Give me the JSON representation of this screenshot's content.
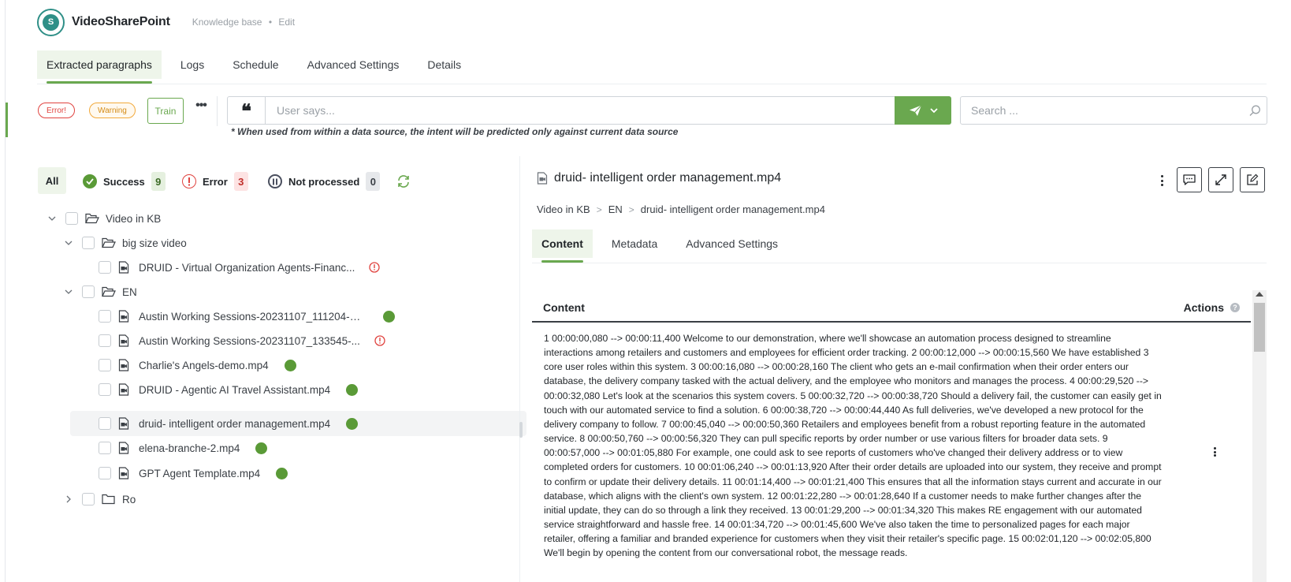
{
  "header": {
    "app_title": "VideoSharePoint",
    "logo_letter": "S",
    "breadcrumb_section": "Knowledge base",
    "breadcrumb_sep": "•",
    "breadcrumb_action": "Edit"
  },
  "tabs": [
    {
      "label": "Extracted paragraphs",
      "active": true
    },
    {
      "label": "Logs"
    },
    {
      "label": "Schedule"
    },
    {
      "label": "Advanced Settings"
    },
    {
      "label": "Details"
    }
  ],
  "toolbar": {
    "error_pill": "Error!",
    "warning_pill": "Warning",
    "train_label": "Train",
    "more_label": "•••",
    "quote_glyph": "❝",
    "user_says_placeholder": "User says...",
    "intent_note": "* When used from within a data source, the intent will be predicted only against current data source",
    "search_placeholder": "Search ..."
  },
  "filters": {
    "all_label": "All",
    "success_label": "Success",
    "success_count": "9",
    "error_label": "Error",
    "error_count": "3",
    "not_processed_label": "Not processed",
    "not_processed_count": "0"
  },
  "tree": {
    "root": "Video in KB",
    "folder_big": "big size video",
    "file_druid_virtual": "DRUID - Virtual Organization Agents-Financ...",
    "folder_en": "EN",
    "file_austin_1": "Austin Working Sessions-20231107_111204-M...",
    "file_austin_2": "Austin Working Sessions-20231107_133545-...",
    "file_charlie": "Charlie's Angels-demo.mp4",
    "file_travel": "DRUID - Agentic AI Travel Assistant.mp4",
    "file_order": "druid- intelligent order management.mp4",
    "file_elena": "elena-branche-2.mp4",
    "file_gpt": "GPT Agent Template.mp4",
    "folder_ro": "Ro"
  },
  "document": {
    "title": "druid- intelligent order management.mp4",
    "crumbs": [
      "Video in KB",
      "EN",
      "druid- intelligent order management.mp4"
    ],
    "crumb_sep": ">",
    "sub_tabs": [
      {
        "label": "Content",
        "active": true
      },
      {
        "label": "Metadata"
      },
      {
        "label": "Advanced Settings"
      }
    ],
    "content_header": "Content",
    "actions_header": "Actions",
    "help_glyph": "?",
    "content_text": "1 00:00:00,080 --> 00:00:11,400 Welcome to our demonstration, where we'll showcase an automation process designed to streamline interactions among retailers and customers and employees for efficient order tracking. 2 00:00:12,000 --> 00:00:15,560 We have established 3 core user roles within this system. 3 00:00:16,080 --> 00:00:28,160 The client who gets an e-mail confirmation when their order enters our database, the delivery company tasked with the actual delivery, and the employee who monitors and manages the process. 4 00:00:29,520 --> 00:00:32,080 Let's look at the scenarios this system covers. 5 00:00:32,720 --> 00:00:38,720 Should a delivery fail, the customer can easily get in touch with our automated service to find a solution. 6 00:00:38,720 --> 00:00:44,440 As full deliveries, we've developed a new protocol for the delivery company to follow. 7 00:00:45,040 --> 00:00:50,360 Retailers and employees benefit from a robust reporting feature in the automated service. 8 00:00:50,760 --> 00:00:56,320 They can pull specific reports by order number or use various filters for broader data sets. 9 00:00:57,000 --> 00:01:05,880 For example, one could ask to see reports of customers who've changed their delivery address or to view completed orders for customers. 10 00:01:06,240 --> 00:01:13,920 After their order details are uploaded into our system, they receive and prompt to confirm or update their delivery details. 11 00:01:14,400 --> 00:01:21,400 This ensures that all the information stays current and accurate in our database, which aligns with the client's own system. 12 00:01:22,280 --> 00:01:28,640 If a customer needs to make further changes after the initial update, they can do so through a link they received. 13 00:01:29,200 --> 00:01:34,320 This makes RE engagement with our automated service straightforward and hassle free. 14 00:01:34,720 --> 00:01:45,600 We've also taken the time to personalized pages for each major retailer, offering a familiar and branded experience for customers when they visit their retailer's specific page. 15 00:02:01,120 --> 00:02:05,800 We'll begin by opening the content from our conversational robot, the message reads."
  },
  "colors": {
    "accent_green": "#6aa84f",
    "success_green": "#5a9a37",
    "error_red": "#e0433f",
    "warning_orange": "#f2a93b"
  },
  "icons": [
    "logo-icon",
    "quote-icon",
    "send-icon",
    "chevron-down-icon",
    "search-icon",
    "check-circle-icon",
    "alert-circle-icon",
    "pause-circle-icon",
    "refresh-icon",
    "folder-open-icon",
    "folder-icon",
    "file-video-icon",
    "kebab-icon",
    "comment-icon",
    "expand-icon",
    "edit-icon"
  ]
}
